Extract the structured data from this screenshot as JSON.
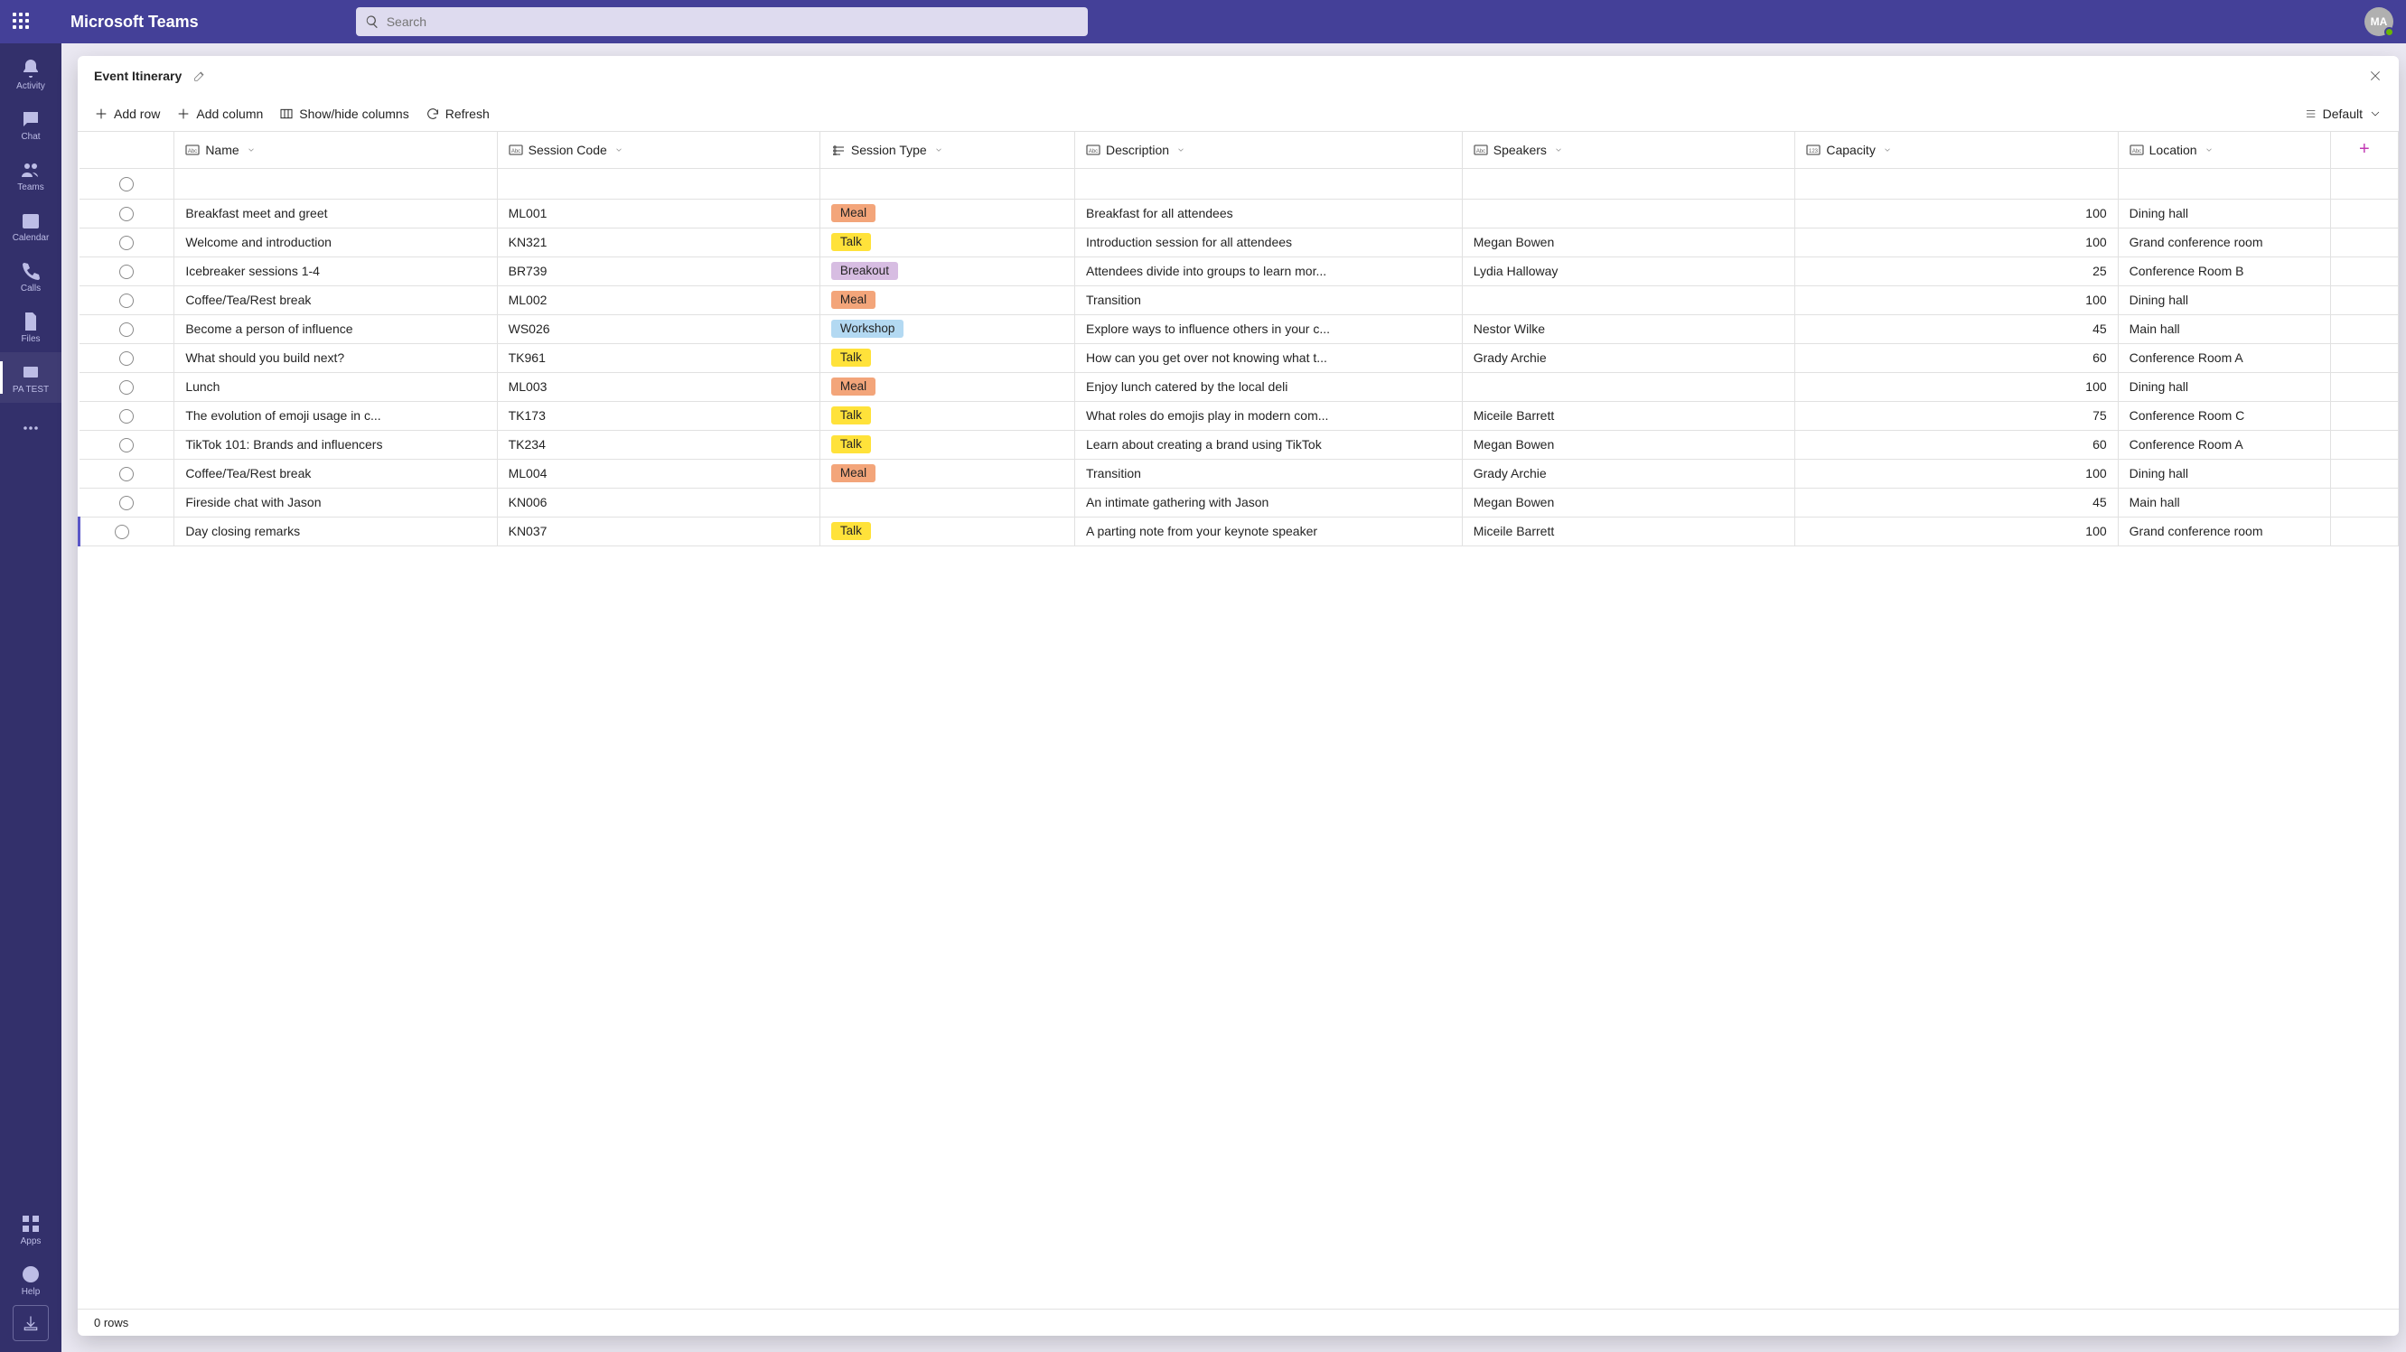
{
  "header": {
    "app_title": "Microsoft Teams",
    "search_placeholder": "Search",
    "avatar_initials": "MA"
  },
  "rail": {
    "items": [
      {
        "icon": "bell",
        "label": "Activity"
      },
      {
        "icon": "chat",
        "label": "Chat"
      },
      {
        "icon": "teams",
        "label": "Teams"
      },
      {
        "icon": "calendar",
        "label": "Calendar"
      },
      {
        "icon": "calls",
        "label": "Calls"
      },
      {
        "icon": "files",
        "label": "Files"
      },
      {
        "icon": "pa",
        "label": "PA TEST",
        "active": true
      },
      {
        "icon": "more",
        "label": ""
      }
    ],
    "bottom": [
      {
        "icon": "apps",
        "label": "Apps"
      },
      {
        "icon": "help",
        "label": "Help"
      }
    ]
  },
  "panel": {
    "title": "Event Itinerary",
    "toolbar": {
      "add_row": "Add row",
      "add_column": "Add column",
      "show_hide": "Show/hide columns",
      "refresh": "Refresh",
      "view_label": "Default"
    },
    "columns": [
      {
        "key": "name",
        "label": "Name",
        "icon": "abc"
      },
      {
        "key": "sessionCode",
        "label": "Session Code",
        "icon": "abc"
      },
      {
        "key": "sessionType",
        "label": "Session Type",
        "icon": "opt"
      },
      {
        "key": "description",
        "label": "Description",
        "icon": "abc"
      },
      {
        "key": "speakers",
        "label": "Speakers",
        "icon": "abc"
      },
      {
        "key": "capacity",
        "label": "Capacity",
        "icon": "num"
      },
      {
        "key": "location",
        "label": "Location",
        "icon": "abc"
      }
    ],
    "rows": [
      {
        "name": "Breakfast meet and greet",
        "sessionCode": "ML001",
        "sessionType": "Meal",
        "description": "Breakfast for all attendees",
        "speakers": "",
        "capacity": 100,
        "location": "Dining hall"
      },
      {
        "name": "Welcome and introduction",
        "sessionCode": "KN321",
        "sessionType": "Talk",
        "description": "Introduction session for all attendees",
        "speakers": "Megan Bowen",
        "capacity": 100,
        "location": "Grand conference room"
      },
      {
        "name": "Icebreaker sessions 1-4",
        "sessionCode": "BR739",
        "sessionType": "Breakout",
        "description": "Attendees divide into groups to learn mor...",
        "speakers": "Lydia Halloway",
        "capacity": 25,
        "location": "Conference Room B"
      },
      {
        "name": "Coffee/Tea/Rest break",
        "sessionCode": "ML002",
        "sessionType": "Meal",
        "description": "Transition",
        "speakers": "",
        "capacity": 100,
        "location": "Dining hall"
      },
      {
        "name": "Become a person of influence",
        "sessionCode": "WS026",
        "sessionType": "Workshop",
        "description": "Explore ways to influence others in your c...",
        "speakers": "Nestor Wilke",
        "capacity": 45,
        "location": "Main hall"
      },
      {
        "name": "What should you build next?",
        "sessionCode": "TK961",
        "sessionType": "Talk",
        "description": "How can you get over not knowing what t...",
        "speakers": "Grady Archie",
        "capacity": 60,
        "location": "Conference Room A"
      },
      {
        "name": "Lunch",
        "sessionCode": "ML003",
        "sessionType": "Meal",
        "description": "Enjoy lunch catered by the local deli",
        "speakers": "",
        "capacity": 100,
        "location": "Dining hall"
      },
      {
        "name": "The evolution of emoji usage in c...",
        "sessionCode": "TK173",
        "sessionType": "Talk",
        "description": "What roles do emojis play in modern com...",
        "speakers": "Miceile Barrett",
        "capacity": 75,
        "location": "Conference Room C"
      },
      {
        "name": "TikTok 101: Brands and influencers",
        "sessionCode": "TK234",
        "sessionType": "Talk",
        "description": "Learn about creating a brand using TikTok",
        "speakers": "Megan Bowen",
        "capacity": 60,
        "location": "Conference Room A"
      },
      {
        "name": "Coffee/Tea/Rest break",
        "sessionCode": "ML004",
        "sessionType": "Meal",
        "description": "Transition",
        "speakers": "Grady Archie",
        "capacity": 100,
        "location": "Dining hall"
      },
      {
        "name": "Fireside chat with Jason",
        "sessionCode": "KN006",
        "sessionType": "",
        "description": "An intimate gathering with Jason",
        "speakers": "Megan Bowen",
        "capacity": 45,
        "location": "Main hall"
      },
      {
        "name": "Day closing remarks",
        "sessionCode": "KN037",
        "sessionType": "Talk",
        "description": "A parting note from your keynote speaker",
        "speakers": "Miceile Barrett",
        "capacity": 100,
        "location": "Grand conference room",
        "selected": true
      }
    ],
    "footer_rows": "0 rows"
  },
  "pill_class": {
    "Meal": "pill-meal",
    "Talk": "pill-talk",
    "Breakout": "pill-breakout",
    "Workshop": "pill-workshop"
  }
}
